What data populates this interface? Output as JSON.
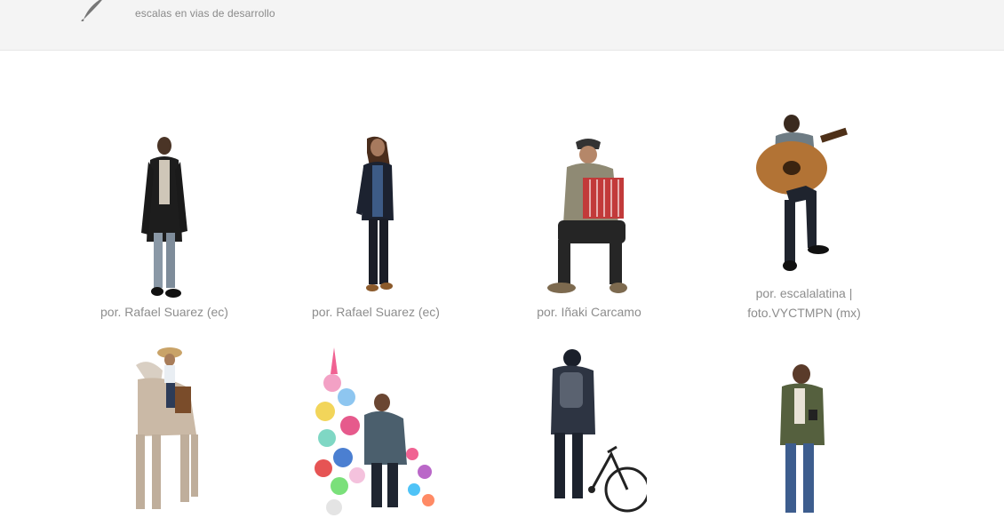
{
  "header": {
    "tagline": "escalas en vias de desarrollo",
    "logo_icon": "feather-logo-icon"
  },
  "gallery": {
    "items": [
      {
        "figure": "standing-man-coat-icon",
        "caption_lines": [
          "por. Rafael Suarez (ec)"
        ]
      },
      {
        "figure": "standing-woman-blazer-icon",
        "caption_lines": [
          "por. Rafael Suarez (ec)"
        ]
      },
      {
        "figure": "seated-accordion-player-icon",
        "caption_lines": [
          "por. Iñaki Carcamo"
        ]
      },
      {
        "figure": "seated-guitar-player-icon",
        "caption_lines": [
          "por. escalalatina |",
          "foto.VYCTMPN (mx)"
        ]
      },
      {
        "figure": "child-on-horse-icon",
        "caption_lines": []
      },
      {
        "figure": "balloon-vendor-icon",
        "caption_lines": []
      },
      {
        "figure": "man-with-bicycle-icon",
        "caption_lines": []
      },
      {
        "figure": "man-with-phone-icon",
        "caption_lines": []
      }
    ]
  },
  "colors": {
    "header_bg": "#f4f4f4",
    "caption": "#8d8d8d",
    "tagline": "#8a8a8a"
  }
}
